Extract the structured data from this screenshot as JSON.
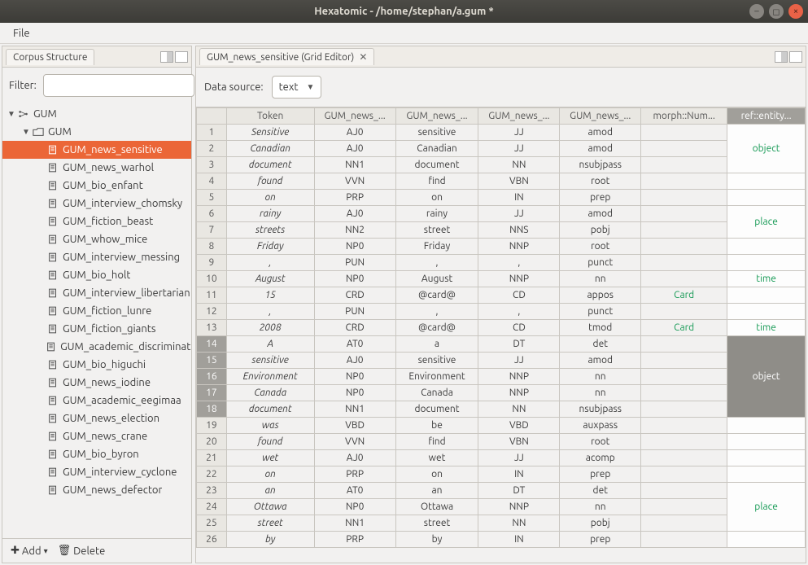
{
  "window": {
    "title": "Hexatomic - /home/stephan/a.gum *"
  },
  "menu": {
    "file": "File"
  },
  "corpus_panel": {
    "tab": "Corpus Structure",
    "filter_label": "Filter:",
    "filter_value": "",
    "add_label": "Add",
    "delete_label": "Delete",
    "tree": [
      {
        "depth": 0,
        "kind": "corpus",
        "expand": "▼",
        "label": "GUM"
      },
      {
        "depth": 1,
        "kind": "folder",
        "expand": "▼",
        "label": "GUM"
      },
      {
        "depth": 2,
        "kind": "doc",
        "label": "GUM_news_sensitive",
        "selected": true
      },
      {
        "depth": 2,
        "kind": "doc",
        "label": "GUM_news_warhol"
      },
      {
        "depth": 2,
        "kind": "doc",
        "label": "GUM_bio_enfant"
      },
      {
        "depth": 2,
        "kind": "doc",
        "label": "GUM_interview_chomsky"
      },
      {
        "depth": 2,
        "kind": "doc",
        "label": "GUM_fiction_beast"
      },
      {
        "depth": 2,
        "kind": "doc",
        "label": "GUM_whow_mice"
      },
      {
        "depth": 2,
        "kind": "doc",
        "label": "GUM_interview_messing"
      },
      {
        "depth": 2,
        "kind": "doc",
        "label": "GUM_bio_holt"
      },
      {
        "depth": 2,
        "kind": "doc",
        "label": "GUM_interview_libertarian"
      },
      {
        "depth": 2,
        "kind": "doc",
        "label": "GUM_fiction_lunre"
      },
      {
        "depth": 2,
        "kind": "doc",
        "label": "GUM_fiction_giants"
      },
      {
        "depth": 2,
        "kind": "doc",
        "label": "GUM_academic_discrimination"
      },
      {
        "depth": 2,
        "kind": "doc",
        "label": "GUM_bio_higuchi"
      },
      {
        "depth": 2,
        "kind": "doc",
        "label": "GUM_news_iodine"
      },
      {
        "depth": 2,
        "kind": "doc",
        "label": "GUM_academic_eegimaa"
      },
      {
        "depth": 2,
        "kind": "doc",
        "label": "GUM_news_election"
      },
      {
        "depth": 2,
        "kind": "doc",
        "label": "GUM_news_crane"
      },
      {
        "depth": 2,
        "kind": "doc",
        "label": "GUM_bio_byron"
      },
      {
        "depth": 2,
        "kind": "doc",
        "label": "GUM_interview_cyclone"
      },
      {
        "depth": 2,
        "kind": "doc",
        "label": "GUM_news_defector"
      }
    ]
  },
  "editor": {
    "tab": "GUM_news_sensitive (Grid Editor)",
    "ds_label": "Data source:",
    "ds_value": "text",
    "columns": [
      "",
      "Token",
      "GUM_news_...",
      "GUM_news_...",
      "GUM_news_...",
      "GUM_news_...",
      "morph::Num...",
      "ref::entity..."
    ],
    "selected_col": 7,
    "selected_rows_start": 14,
    "selected_rows_end": 18,
    "ref_spans": [
      {
        "start": 1,
        "end": 3,
        "label": "object"
      },
      {
        "start": 6,
        "end": 7,
        "label": "place"
      },
      {
        "start": 10,
        "end": 10,
        "label": "time"
      },
      {
        "start": 13,
        "end": 13,
        "label": "time"
      },
      {
        "start": 14,
        "end": 18,
        "label": "object",
        "selected": true
      },
      {
        "start": 23,
        "end": 25,
        "label": "place"
      }
    ],
    "rows": [
      {
        "n": 1,
        "tok": "Sensitive",
        "c2": "AJ0",
        "c3": "sensitive",
        "c4": "JJ",
        "c5": "amod",
        "c6": ""
      },
      {
        "n": 2,
        "tok": "Canadian",
        "c2": "AJ0",
        "c3": "Canadian",
        "c4": "JJ",
        "c5": "amod",
        "c6": ""
      },
      {
        "n": 3,
        "tok": "document",
        "c2": "NN1",
        "c3": "document",
        "c4": "NN",
        "c5": "nsubjpass",
        "c6": ""
      },
      {
        "n": 4,
        "tok": "found",
        "c2": "VVN",
        "c3": "find",
        "c4": "VBN",
        "c5": "root",
        "c6": ""
      },
      {
        "n": 5,
        "tok": "on",
        "c2": "PRP",
        "c3": "on",
        "c4": "IN",
        "c5": "prep",
        "c6": ""
      },
      {
        "n": 6,
        "tok": "rainy",
        "c2": "AJ0",
        "c3": "rainy",
        "c4": "JJ",
        "c5": "amod",
        "c6": ""
      },
      {
        "n": 7,
        "tok": "streets",
        "c2": "NN2",
        "c3": "street",
        "c4": "NNS",
        "c5": "pobj",
        "c6": ""
      },
      {
        "n": 8,
        "tok": "Friday",
        "c2": "NP0",
        "c3": "Friday",
        "c4": "NNP",
        "c5": "root",
        "c6": ""
      },
      {
        "n": 9,
        "tok": ",",
        "c2": "PUN",
        "c3": ",",
        "c4": ",",
        "c5": "punct",
        "c6": ""
      },
      {
        "n": 10,
        "tok": "August",
        "c2": "NP0",
        "c3": "August",
        "c4": "NNP",
        "c5": "nn",
        "c6": ""
      },
      {
        "n": 11,
        "tok": "15",
        "c2": "CRD",
        "c3": "@card@",
        "c4": "CD",
        "c5": "appos",
        "c6": "Card"
      },
      {
        "n": 12,
        "tok": ",",
        "c2": "PUN",
        "c3": ",",
        "c4": ",",
        "c5": "punct",
        "c6": ""
      },
      {
        "n": 13,
        "tok": "2008",
        "c2": "CRD",
        "c3": "@card@",
        "c4": "CD",
        "c5": "tmod",
        "c6": "Card"
      },
      {
        "n": 14,
        "tok": "A",
        "c2": "AT0",
        "c3": "a",
        "c4": "DT",
        "c5": "det",
        "c6": ""
      },
      {
        "n": 15,
        "tok": "sensitive",
        "c2": "AJ0",
        "c3": "sensitive",
        "c4": "JJ",
        "c5": "amod",
        "c6": ""
      },
      {
        "n": 16,
        "tok": "Environment",
        "c2": "NP0",
        "c3": "Environment",
        "c4": "NNP",
        "c5": "nn",
        "c6": ""
      },
      {
        "n": 17,
        "tok": "Canada",
        "c2": "NP0",
        "c3": "Canada",
        "c4": "NNP",
        "c5": "nn",
        "c6": ""
      },
      {
        "n": 18,
        "tok": "document",
        "c2": "NN1",
        "c3": "document",
        "c4": "NN",
        "c5": "nsubjpass",
        "c6": ""
      },
      {
        "n": 19,
        "tok": "was",
        "c2": "VBD",
        "c3": "be",
        "c4": "VBD",
        "c5": "auxpass",
        "c6": ""
      },
      {
        "n": 20,
        "tok": "found",
        "c2": "VVN",
        "c3": "find",
        "c4": "VBN",
        "c5": "root",
        "c6": ""
      },
      {
        "n": 21,
        "tok": "wet",
        "c2": "AJ0",
        "c3": "wet",
        "c4": "JJ",
        "c5": "acomp",
        "c6": ""
      },
      {
        "n": 22,
        "tok": "on",
        "c2": "PRP",
        "c3": "on",
        "c4": "IN",
        "c5": "prep",
        "c6": ""
      },
      {
        "n": 23,
        "tok": "an",
        "c2": "AT0",
        "c3": "an",
        "c4": "DT",
        "c5": "det",
        "c6": ""
      },
      {
        "n": 24,
        "tok": "Ottawa",
        "c2": "NP0",
        "c3": "Ottawa",
        "c4": "NNP",
        "c5": "nn",
        "c6": ""
      },
      {
        "n": 25,
        "tok": "street",
        "c2": "NN1",
        "c3": "street",
        "c4": "NN",
        "c5": "pobj",
        "c6": ""
      },
      {
        "n": 26,
        "tok": "by",
        "c2": "PRP",
        "c3": "by",
        "c4": "IN",
        "c5": "prep",
        "c6": ""
      }
    ]
  }
}
